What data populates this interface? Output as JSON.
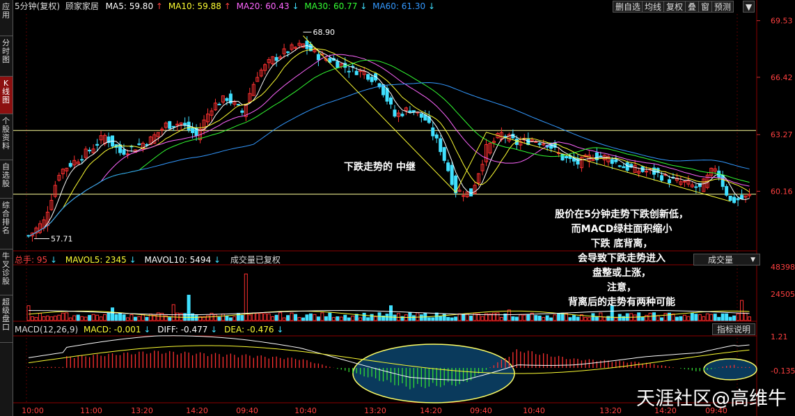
{
  "sidebar": {
    "tabs": [
      {
        "label": "应用",
        "active": false
      },
      {
        "label": "分时图",
        "active": false
      },
      {
        "label": "K线图",
        "active": true
      },
      {
        "label": "个股资料",
        "active": false
      },
      {
        "label": "自选股",
        "active": false
      },
      {
        "label": "综合排名",
        "active": false
      },
      {
        "label": "牛叉诊股",
        "active": false
      },
      {
        "label": "超级盘口",
        "active": false
      }
    ]
  },
  "header": {
    "period": "5分钟(复权)",
    "stock_name": "顾家家居",
    "ma5": "MA5: 59.80",
    "ma10": "MA10: 59.88",
    "ma20": "MA20: 60.43",
    "ma30": "MA30: 60.77",
    "ma60": "MA60: 61.30",
    "arrow_up": "↑",
    "arrow_down": "↓"
  },
  "toolbar": {
    "delete_fav": "删自选",
    "avg_line": "均线",
    "adjust": "复权",
    "overlay": "叠",
    "window": "窗",
    "forecast": "预测",
    "expand": "▼"
  },
  "price_axis": {
    "top": "69.53",
    "l2": "66.42",
    "l3": "63.27",
    "l4": "60.16"
  },
  "price_marks": {
    "high": "68.90",
    "low": "57.71"
  },
  "volume_header": {
    "total": "总手: 95",
    "mavol5": "MAVOL5: 2345",
    "mavol10": "MAVOL10: 5494",
    "note": "成交量已复权",
    "selector": "成交量"
  },
  "volume_axis": {
    "top": "48398",
    "mid": "24505"
  },
  "macd_header": {
    "label": "MACD(12,26,9)",
    "macd": "MACD: -0.001",
    "diff": "DIFF: -0.477",
    "dea": "DEA: -0.476",
    "help": "指标说明"
  },
  "macd_axis": {
    "top": "1.21",
    "mid": "-0.135"
  },
  "time_axis": [
    "10:00",
    "11:00",
    "13:20",
    "14:20",
    "09:40",
    "10:40",
    "13:20",
    "14:20",
    "09:40",
    "10:40",
    "13:20",
    "14:20",
    "09:40"
  ],
  "annotations": {
    "middle": "下跌走势的 中继",
    "right_lines": [
      "股价在5分钟走势下跌创新低，",
      "而MACD绿柱面积缩小",
      "下跌 底背离，",
      "会导致下跌走势进入",
      "盘整或上涨，",
      "注意，",
      "背离后的走势有两种可能"
    ]
  },
  "watermark": "天涯社区@高维牛",
  "colors": {
    "up": "#ff3030",
    "down": "#40e0ff",
    "ma5": "#ffffff",
    "ma10": "#ffff33",
    "ma20": "#ff66ff",
    "ma30": "#33ff33",
    "ma60": "#3399ff",
    "grid": "#8b0000",
    "support": "#ffff99",
    "ellipse": "#0a3a5c",
    "ellipse_border": "#ffff66"
  },
  "chart_data": {
    "type": "candlestick",
    "title": "顾家家居 5分钟(复权)",
    "ylim": [
      57.0,
      69.9
    ],
    "y_ticks": [
      69.53,
      66.42,
      63.27,
      60.16
    ],
    "support_levels": [
      63.5,
      60.0
    ],
    "high": 68.9,
    "low": 57.71,
    "price_path": [
      [
        0,
        57.7
      ],
      [
        4,
        58.5
      ],
      [
        8,
        61.2
      ],
      [
        12,
        61.8
      ],
      [
        16,
        62.4
      ],
      [
        20,
        63.2
      ],
      [
        24,
        62.3
      ],
      [
        28,
        62.6
      ],
      [
        32,
        63.0
      ],
      [
        36,
        63.8
      ],
      [
        40,
        63.9
      ],
      [
        44,
        63.2
      ],
      [
        48,
        64.8
      ],
      [
        52,
        65.3
      ],
      [
        56,
        64.5
      ],
      [
        60,
        66.6
      ],
      [
        64,
        67.4
      ],
      [
        68,
        67.9
      ],
      [
        72,
        68.2
      ],
      [
        76,
        67.6
      ],
      [
        80,
        67.3
      ],
      [
        84,
        66.9
      ],
      [
        88,
        66.7
      ],
      [
        92,
        66.1
      ],
      [
        96,
        64.3
      ],
      [
        100,
        64.7
      ],
      [
        104,
        64.1
      ],
      [
        108,
        62.5
      ],
      [
        112,
        60.2
      ],
      [
        116,
        60.0
      ],
      [
        120,
        62.5
      ],
      [
        124,
        63.3
      ],
      [
        128,
        62.8
      ],
      [
        132,
        63.0
      ],
      [
        136,
        62.8
      ],
      [
        140,
        62.0
      ],
      [
        144,
        61.7
      ],
      [
        148,
        62.1
      ],
      [
        152,
        62.0
      ],
      [
        156,
        61.5
      ],
      [
        160,
        61.3
      ],
      [
        164,
        61.2
      ],
      [
        168,
        60.8
      ],
      [
        172,
        60.6
      ],
      [
        176,
        60.3
      ],
      [
        180,
        61.5
      ],
      [
        184,
        59.6
      ],
      [
        188,
        59.8
      ],
      [
        190,
        60.0
      ]
    ],
    "volume_peaks": [
      [
        0,
        14000
      ],
      [
        30,
        12000
      ],
      [
        52,
        15000
      ],
      [
        58,
        24000
      ],
      [
        78,
        44000
      ],
      [
        130,
        14000
      ],
      [
        172,
        10000
      ],
      [
        210,
        14000
      ],
      [
        256,
        19000
      ]
    ],
    "macd_hist_peaks": [
      [
        20,
        0.6
      ],
      [
        70,
        0.9
      ],
      [
        120,
        0.7
      ],
      [
        150,
        0.5
      ],
      [
        180,
        -0.3
      ],
      [
        210,
        -1.1
      ],
      [
        240,
        -0.9
      ],
      [
        270,
        1.0
      ],
      [
        300,
        0.5
      ],
      [
        340,
        0.3
      ],
      [
        370,
        -0.2
      ],
      [
        390,
        0.2
      ]
    ],
    "ellipses": [
      "green-bar area 1",
      "green-bar area 2"
    ]
  }
}
